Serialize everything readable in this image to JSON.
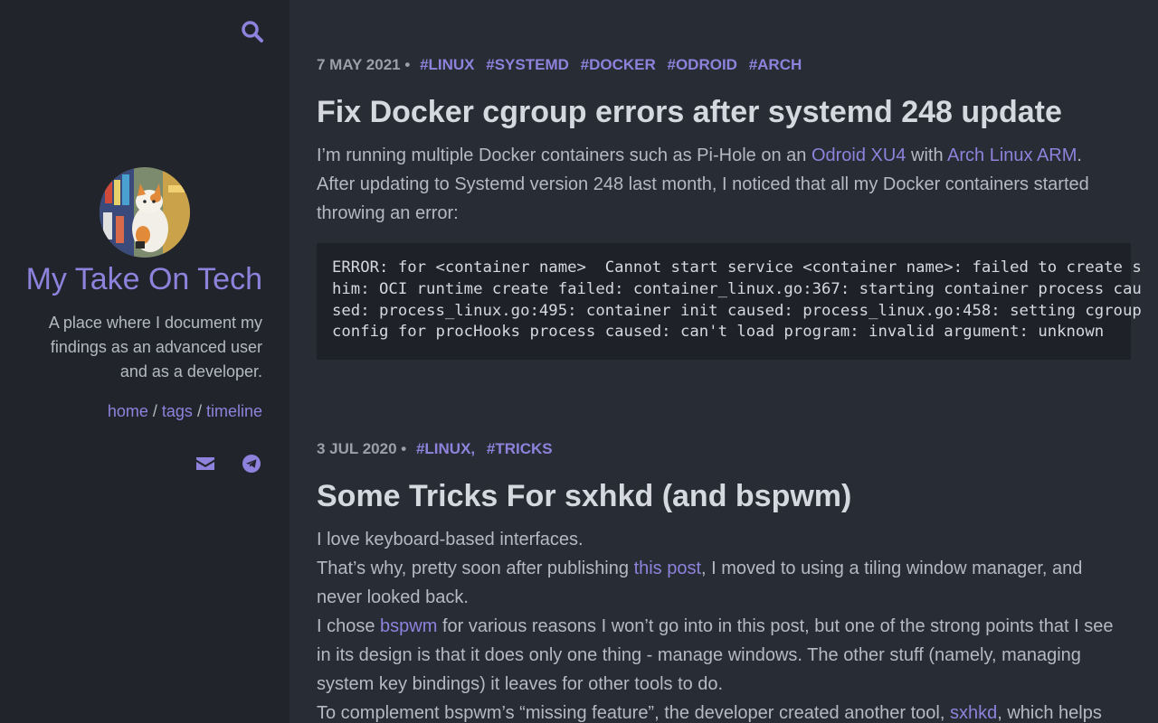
{
  "sidebar": {
    "title": "My Take On Tech",
    "tagline": "A place where I document my findings as an advanced user and as a developer.",
    "nav": {
      "home": "home",
      "tags": "tags",
      "timeline": "timeline",
      "sep": "/"
    },
    "icons": {
      "search": "search-icon",
      "email": "envelope-icon",
      "telegram": "telegram-icon"
    }
  },
  "posts": [
    {
      "date": "7 MAY 2021",
      "sep": "•",
      "tags": [
        "#LINUX",
        "#SYSTEMD",
        "#DOCKER",
        "#ODROID",
        "#ARCH"
      ],
      "title": "Fix Docker cgroup errors after systemd 248 update",
      "p1_a": "I’m running multiple Docker containers such as Pi-Hole on an ",
      "p1_link1": "Odroid XU4",
      "p1_b": " with ",
      "p1_link2": "Arch Linux ARM",
      "p1_c": ".",
      "p2": "After updating to Systemd version 248 last month, I noticed that all my Docker containers started throwing an error:",
      "code": [
        "ERROR: for <container name>  Cannot start service <container name>: failed to create s",
        "him: OCI runtime create failed: container_linux.go:367: starting container process cau",
        "sed: process_linux.go:495: container init caused: process_linux.go:458: setting cgroup",
        "config for procHooks process caused: can't load program: invalid argument: unknown"
      ]
    },
    {
      "date": "3 JUL 2020",
      "sep": "•",
      "tags": [
        "#LINUX,",
        "#TRICKS"
      ],
      "title": "Some Tricks For sxhkd (and bspwm)",
      "p1": "I love keyboard-based interfaces.",
      "p2_a": "That’s why, pretty soon after publishing ",
      "p2_link": "this post",
      "p2_b": ", I moved to using a tiling window manager, and never looked back.",
      "p3_a": "I chose ",
      "p3_link": "bspwm",
      "p3_b": " for various reasons I won’t go into in this post, but one of the strong points that I see in its design is that it does only one thing - manage windows. The other stuff (namely, managing system key bindings) it leaves for other tools to do.",
      "p4_a": "To complement bspwm’s “missing feature”, the developer created another tool, ",
      "p4_link": "sxhkd",
      "p4_b": ", which helps"
    }
  ],
  "colors": {
    "accent": "#8f82dc",
    "bg": "#282c35",
    "sidebar_bg": "#21242b",
    "code_bg": "#1e2127"
  }
}
